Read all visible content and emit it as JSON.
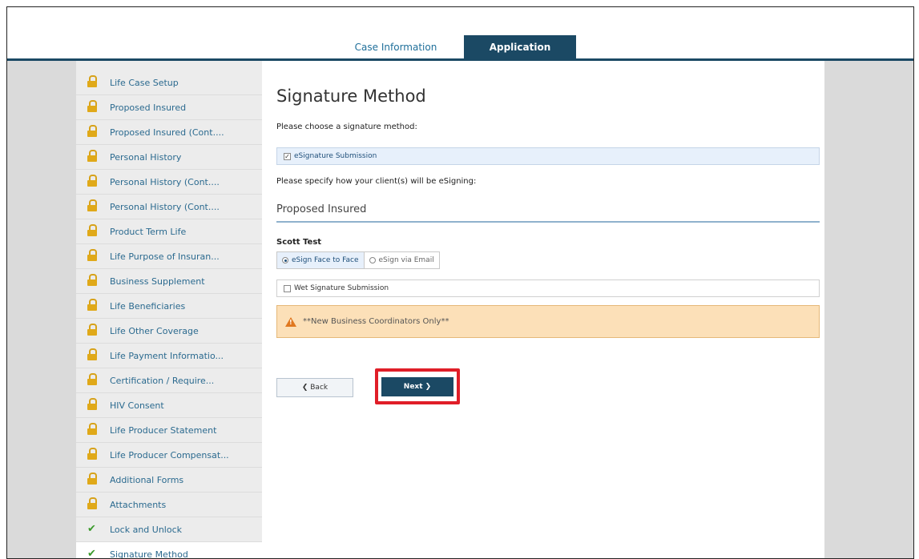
{
  "tabs": {
    "case_information": "Case Information",
    "application": "Application"
  },
  "sidebar": {
    "items": [
      {
        "label": "Life Case Setup",
        "status": "lock-icon"
      },
      {
        "label": "Proposed Insured",
        "status": "lock-icon"
      },
      {
        "label": "Proposed Insured (Cont....",
        "status": "lock-icon"
      },
      {
        "label": "Personal History",
        "status": "lock-icon"
      },
      {
        "label": "Personal History (Cont....",
        "status": "lock-icon"
      },
      {
        "label": "Personal History (Cont....",
        "status": "lock-icon"
      },
      {
        "label": "Product Term Life",
        "status": "lock-icon"
      },
      {
        "label": "Life Purpose of Insuran...",
        "status": "lock-icon"
      },
      {
        "label": "Business Supplement",
        "status": "lock-icon"
      },
      {
        "label": "Life Beneficiaries",
        "status": "lock-icon"
      },
      {
        "label": "Life Other Coverage",
        "status": "lock-icon"
      },
      {
        "label": "Life Payment Informatio...",
        "status": "lock-icon"
      },
      {
        "label": "Certification / Require...",
        "status": "lock-icon"
      },
      {
        "label": "HIV Consent",
        "status": "lock-icon"
      },
      {
        "label": "Life Producer Statement",
        "status": "lock-icon"
      },
      {
        "label": "Life Producer Compensat...",
        "status": "lock-icon"
      },
      {
        "label": "Additional Forms",
        "status": "lock-icon"
      },
      {
        "label": "Attachments",
        "status": "lock-icon"
      },
      {
        "label": "Lock and Unlock",
        "status": "check-icon"
      },
      {
        "label": "Signature Method",
        "status": "check-icon"
      }
    ]
  },
  "main": {
    "title": "Signature Method",
    "prompt_choose": "Please choose a signature method:",
    "esignature_label": "eSignature Submission",
    "esignature_checked": true,
    "prompt_specify": "Please specify how your client(s) will be eSigning:",
    "section_heading": "Proposed Insured",
    "client_name": "Scott Test",
    "esign_options": [
      "eSign Face to Face",
      "eSign via Email"
    ],
    "esign_selected": "eSign Face to Face",
    "wet_signature_label": "Wet Signature Submission",
    "wet_signature_checked": false,
    "warning_text": "**New Business Coordinators Only**",
    "back_label": "❮ Back",
    "next_label": "Next ❯"
  },
  "colors": {
    "brand_navy": "#1b4964",
    "link_blue": "#2b6a8f",
    "highlight_red": "#e01e28",
    "warning_bg": "#fce0b8"
  }
}
